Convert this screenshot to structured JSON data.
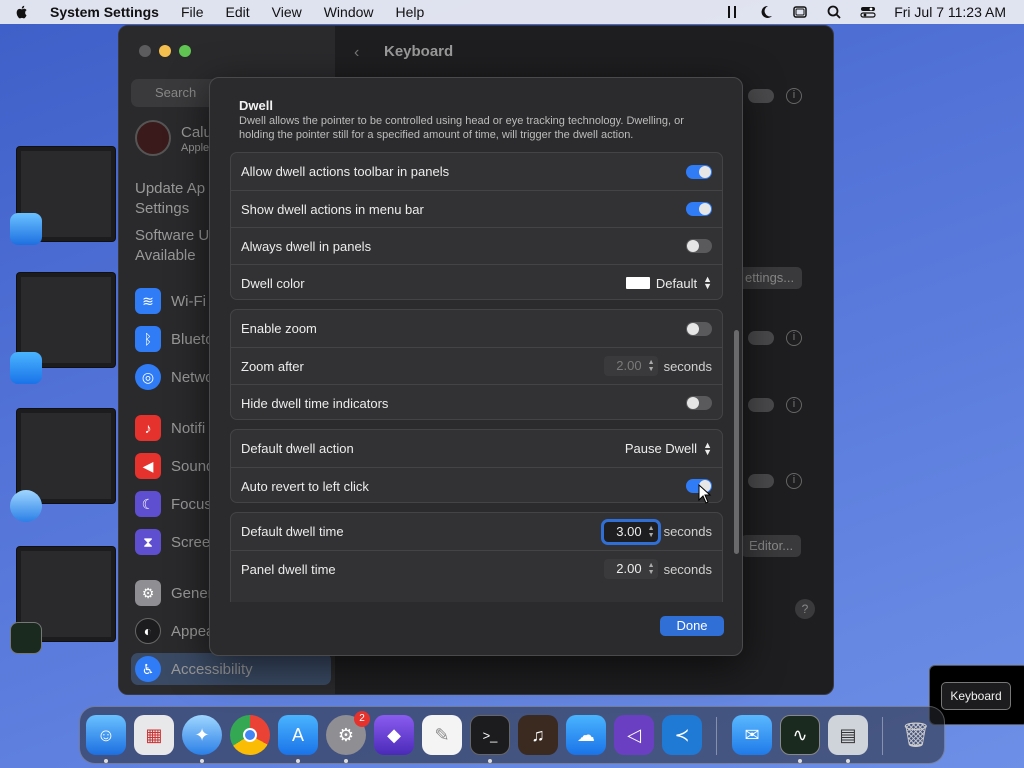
{
  "menubar": {
    "app_name": "System Settings",
    "menus": [
      "File",
      "Edit",
      "View",
      "Window",
      "Help"
    ],
    "clock": "Fri Jul 7  11:23 AM"
  },
  "sidebar": {
    "search_placeholder": "Search",
    "account_name": "Calu",
    "account_sub": "Apple",
    "update_line1": "Update Ap",
    "update_line2": "Settings",
    "software_line1": "Software U",
    "software_line2": "Available",
    "items": [
      {
        "label": "Wi-Fi",
        "icon": "wifi-icon",
        "color": "#2f7cf6"
      },
      {
        "label": "Blueto",
        "icon": "bluetooth-icon",
        "color": "#2f7cf6"
      },
      {
        "label": "Netwo",
        "icon": "network-icon",
        "color": "#2f7cf6"
      },
      {
        "label": "Notifi",
        "icon": "bell-icon",
        "color": "#e5322d"
      },
      {
        "label": "Sound",
        "icon": "speaker-icon",
        "color": "#e5322d"
      },
      {
        "label": "Focus",
        "icon": "moon-icon",
        "color": "#5e4fd1"
      },
      {
        "label": "Scree",
        "icon": "hourglass-icon",
        "color": "#5e4fd1"
      },
      {
        "label": "Gener",
        "icon": "gear-icon",
        "color": "#8e8e93"
      },
      {
        "label": "Appea",
        "icon": "appearance-icon",
        "color": "#1c1c1e"
      },
      {
        "label": "Accessibility",
        "icon": "accessibility-icon",
        "color": "#2f7cf6"
      }
    ]
  },
  "content": {
    "title": "Keyboard",
    "settings_btn": "ettings...",
    "editor_btn": "Editor..."
  },
  "sheet": {
    "title": "Dwell",
    "description": "Dwell allows the pointer to be controlled using head or eye tracking technology. Dwelling, or holding the pointer still for a specified amount of time, will trigger the dwell action.",
    "group1": {
      "allow_toolbar": "Allow dwell actions toolbar in panels",
      "show_menu_bar": "Show dwell actions in menu bar",
      "always_dwell": "Always dwell in panels",
      "dwell_color": "Dwell color",
      "dwell_color_value": "Default"
    },
    "group2": {
      "enable_zoom": "Enable zoom",
      "zoom_after": "Zoom after",
      "zoom_after_value": "2.00",
      "seconds": "seconds",
      "hide_indicators": "Hide dwell time indicators"
    },
    "group3": {
      "default_action": "Default dwell action",
      "default_action_value": "Pause Dwell",
      "auto_revert": "Auto revert to left click"
    },
    "group4": {
      "default_time": "Default dwell time",
      "default_time_value": "3.00",
      "panel_time": "Panel dwell time",
      "panel_time_value": "2.00",
      "seconds": "seconds"
    },
    "done": "Done"
  },
  "tooltip": "Keyboard",
  "dock": {
    "settings_badge": "2"
  }
}
